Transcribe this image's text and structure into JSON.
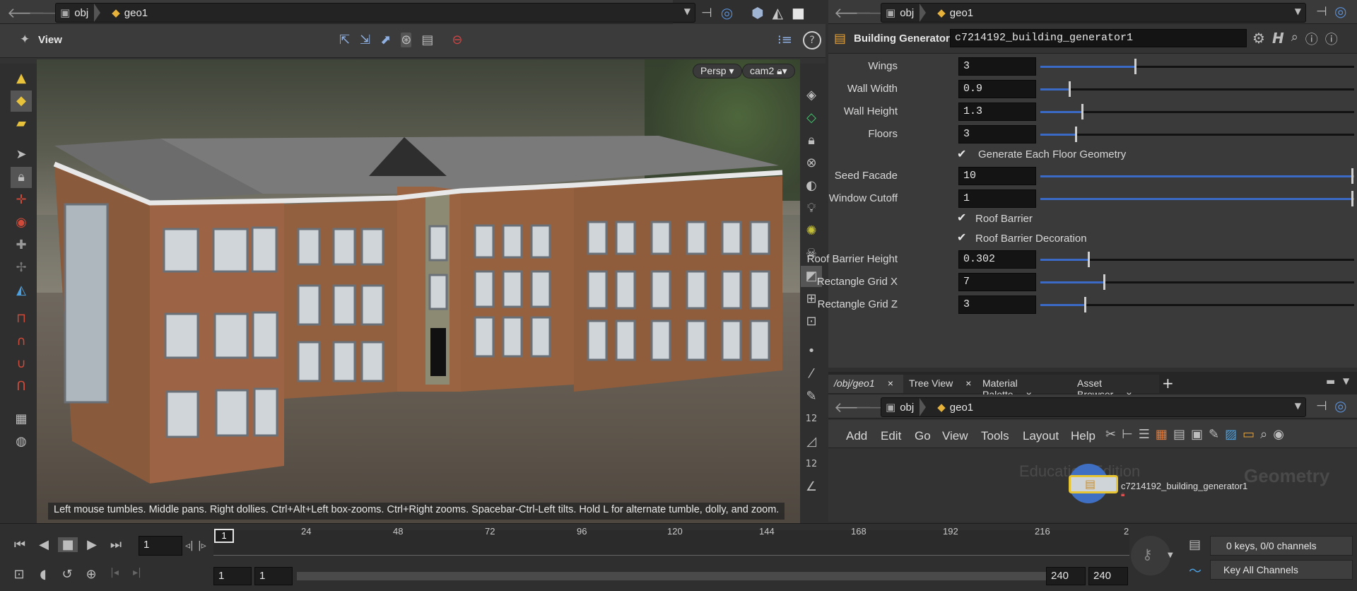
{
  "left_path": {
    "crumbs": [
      "obj",
      "geo1"
    ]
  },
  "right_path": {
    "crumbs": [
      "obj",
      "geo1"
    ]
  },
  "viewer": {
    "title": "View",
    "persp": "Persp",
    "camera": "cam2",
    "status_message": "Left mouse tumbles. Middle pans. Right dollies. Ctrl+Alt+Left box-zooms. Ctrl+Right zooms. Spacebar-Ctrl-Left tilts. Hold L for alternate tumble, dolly, and zoom."
  },
  "node_params": {
    "node_type": "Building Generator",
    "node_name": "c7214192_building_generator1",
    "params": [
      {
        "label": "Wings",
        "value": "3",
        "level": 0.3
      },
      {
        "label": "Wall Width",
        "value": "0.9",
        "level": 0.09
      },
      {
        "label": "Wall Height",
        "value": "1.3",
        "level": 0.13
      },
      {
        "label": "Floors",
        "value": "3",
        "level": 0.11
      },
      {
        "label": "Seed Facade",
        "value": "10",
        "level": 1.0
      },
      {
        "label": "Window Cutoff",
        "value": "1",
        "level": 1.0
      },
      {
        "label": "Roof Barrier Height",
        "value": "0.302",
        "level": 0.15
      },
      {
        "label": "Rectangle Grid X",
        "value": "7",
        "level": 0.2
      },
      {
        "label": "Rectangle Grid Z",
        "value": "3",
        "level": 0.14
      }
    ],
    "checkboxes": [
      {
        "label": "Generate Each Floor Geometry",
        "checked": true
      },
      {
        "label": "Roof Barrier",
        "checked": true
      },
      {
        "label": "Roof Barrier Decoration",
        "checked": true
      }
    ]
  },
  "network": {
    "tabs": [
      "/obj/geo1",
      "Tree View",
      "Material Palette",
      "Asset Browser"
    ],
    "menu": [
      "Add",
      "Edit",
      "Go",
      "View",
      "Tools",
      "Layout",
      "Help"
    ],
    "watermark": "Education Edition",
    "context_label": "Geometry",
    "node_label": "c7214192_building_generator1"
  },
  "timeline": {
    "current_frame": "1",
    "frame_marker": "1",
    "ticks": [
      "24",
      "48",
      "72",
      "96",
      "120",
      "144",
      "168",
      "192",
      "216",
      "2"
    ],
    "range_start": "1",
    "range_start2": "1",
    "range_end": "240",
    "range_end2": "240",
    "keys_status": "0 keys, 0/0 channels",
    "key_all": "Key All Channels"
  },
  "colors": {
    "accent": "#3a6ac6",
    "node_highlight": "#e7c431",
    "panel": "#2f2f2f"
  }
}
